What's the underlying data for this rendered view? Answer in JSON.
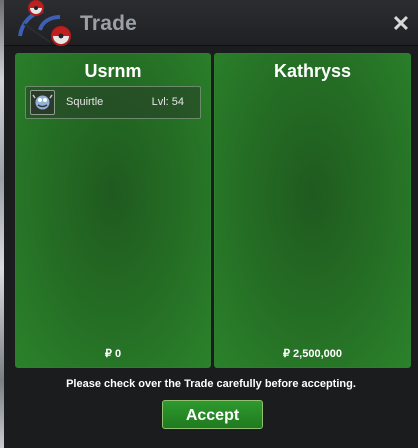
{
  "window": {
    "title": "Trade",
    "close_symbol": "✕"
  },
  "panels": [
    {
      "name": "Usrnm",
      "money": "₽ 0",
      "items": [
        {
          "name": "Squirtle",
          "level": "Lvl: 54",
          "icon": "squirtle-item-icon"
        }
      ]
    },
    {
      "name": "Kathryss",
      "money": "₽ 2,500,000",
      "items": []
    }
  ],
  "notice": "Please check over the Trade carefully before accepting.",
  "accept_label": "Accept",
  "colors": {
    "panel_green": "#256f25",
    "panel_border": "#2f7d2f",
    "button_green": "#1f7a1f",
    "window_bg": "#1b1c1d"
  },
  "icons": {
    "logo": "pokeball-logo-icon",
    "close": "close-icon"
  }
}
